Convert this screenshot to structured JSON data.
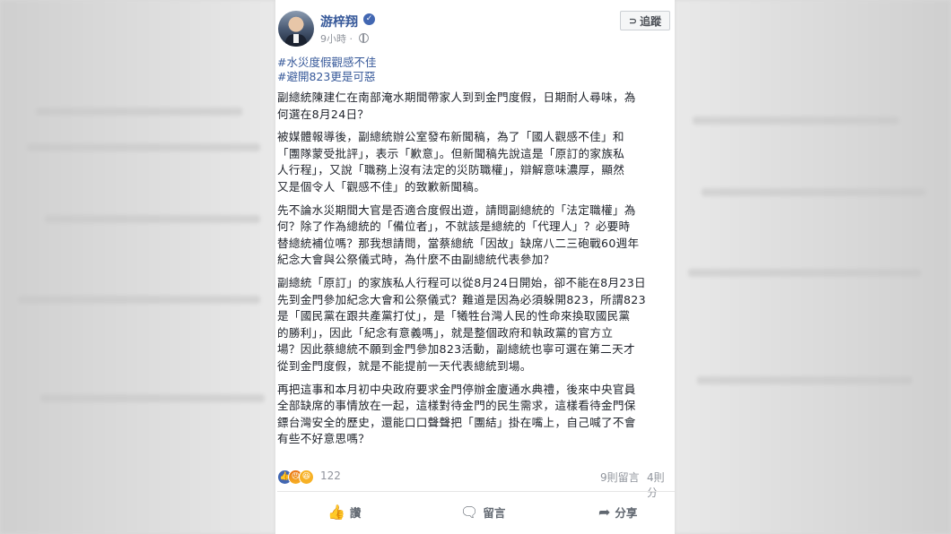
{
  "post": {
    "author_name": "游梓翔",
    "time_text": "9小時",
    "follow_label": "追蹤",
    "hashtags": [
      "#水災度假觀感不佳",
      "#避開823更是可惡"
    ],
    "paragraphs": [
      [
        "副總統陳建仁在南部淹水期間帶家人到到金門度假，日期耐人尋味，為",
        "何選在8月24日？"
      ],
      [
        "被媒體報導後，副總統辦公室發布新聞稿，為了「國人觀感不佳」和",
        "「團隊蒙受批評」，表示「歉意」。但新聞稿先說這是「原訂的家族私",
        "人行程」，又說「職務上沒有法定的災防職權」，辯解意味濃厚，顯然",
        "又是個令人「觀感不佳」的致歉新聞稿。"
      ],
      [
        "先不論水災期間大官是否適合度假出遊，請問副總統的「法定職權」為",
        "何？除了作為總統的「備位者」，不就該是總統的「代理人」？必要時",
        "替總統補位嗎？那我想請問，當蔡總統「因故」缺席八二三砲戰60週年",
        "紀念大會與公祭儀式時，為什麼不由副總統代表參加？"
      ],
      [
        "副總統「原訂」的家族私人行程可以從8月24日開始，卻不能在8月23日",
        "先到金門參加紀念大會和公祭儀式？難道是因為必須躲開823，所謂823",
        "是「國民黨在跟共產黨打仗」，是「犧牲台灣人民的性命來換取國民黨",
        "的勝利」，因此「紀念有意義嗎」，就是整個政府和執政黨的官方立",
        "場？因此蔡總統不願到金門參加823活動，副總統也寧可選在第二天才",
        "從到金門度假，就是不能提前一天代表總統到場。"
      ],
      [
        "再把這事和本月初中央政府要求金門停辦金廈通水典禮，後來中央官員",
        "全部缺席的事情放在一起，這樣對待金門的民生需求，這樣看待金門保",
        "鏢台灣安全的歷史，還能口口聲聲把「團結」掛在嘴上，自己喊了不會",
        "有些不好意思嗎？"
      ]
    ],
    "reaction_count": "122",
    "comment_count": "9則留言",
    "share_count": "4則分",
    "actions": {
      "like_label": "讚",
      "comment_label": "留言",
      "share_label": "分享"
    }
  },
  "icons": [
    "verified-badge-icon",
    "globe-icon",
    "rss-icon",
    "like-reaction-icon",
    "angry-reaction-icon",
    "haha-reaction-icon",
    "thumbs-up-icon",
    "comment-bubble-icon",
    "share-arrow-icon"
  ],
  "colors": {
    "link_blue": "#365899",
    "verified_blue": "#4267b2",
    "meta_gray": "#90949c",
    "text": "#1d2129"
  }
}
